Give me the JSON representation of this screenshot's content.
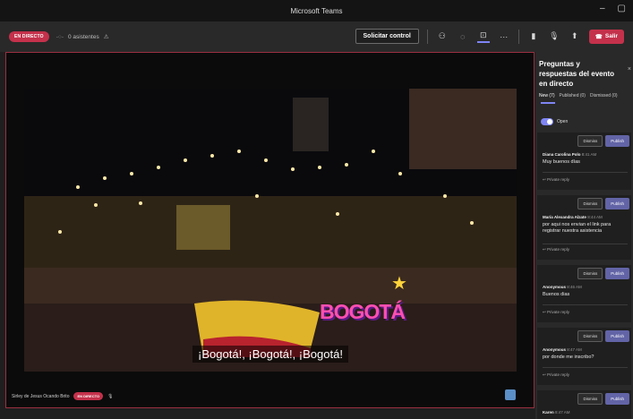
{
  "window": {
    "title": "Microsoft Teams",
    "controls": [
      "–",
      "▢"
    ]
  },
  "toolbar": {
    "live_badge": "EN DIRECTO",
    "attendees": "0 asistentes",
    "request_control": "Solicitar control",
    "leave_label": "Salir"
  },
  "stage": {
    "caption": "¡Bogotá!, ¡Bogotá!, ¡Bogotá!",
    "sign_text": "BOGOTÁ",
    "presenter": "Sirley de Jesus Ocando Brito",
    "live_badge": "EN DIRECTO"
  },
  "qa_panel": {
    "title": "Preguntas y respuestas del evento en directo",
    "tabs": [
      {
        "label": "New (7)",
        "active": true
      },
      {
        "label": "Published (0)",
        "active": false
      },
      {
        "label": "Dismissed (0)",
        "active": false
      }
    ],
    "toggle_label": "Open",
    "dismiss_label": "Dismiss",
    "publish_label": "Publish",
    "reply_label": "Private reply",
    "questions": [
      {
        "author": "Diana Carolina Polo",
        "time": "8:41 AM",
        "text": "Muy buenos días"
      },
      {
        "author": "María Alexandra Alzate",
        "time": "8:44 AM",
        "text": "por aqui nos envian el link para registrar nuestra asistencia"
      },
      {
        "author": "Anonymous",
        "time": "8:46 AM",
        "text": "Buenos dias"
      },
      {
        "author": "Anonymous",
        "time": "8:47 AM",
        "text": "por donde me inscribo?"
      },
      {
        "author": "Karen",
        "time": "8:47 AM",
        "text": ""
      }
    ]
  },
  "colors": {
    "accent": "#6264a7",
    "live": "#c4314b",
    "background": "#1f1f1f"
  }
}
